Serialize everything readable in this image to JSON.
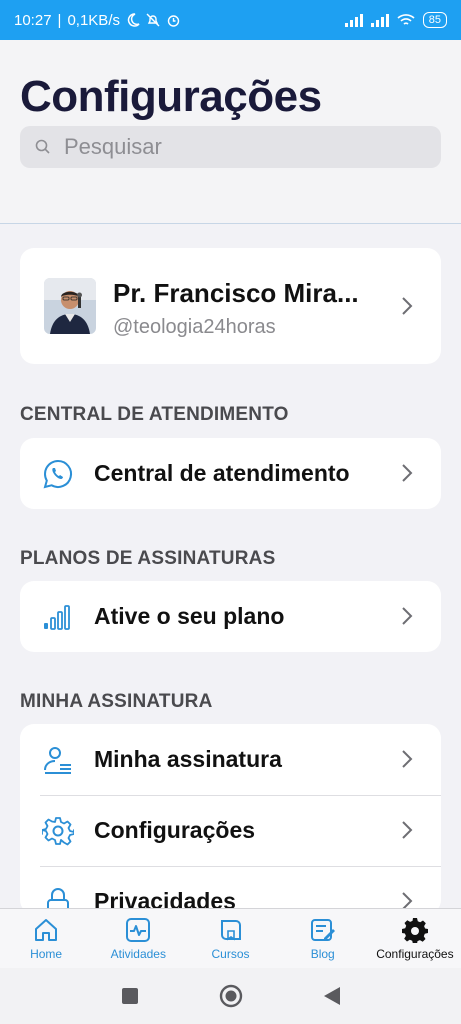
{
  "status": {
    "time": "10:27",
    "speed": "0,1KB/s",
    "battery": "85"
  },
  "header": {
    "title": "Configurações",
    "search_placeholder": "Pesquisar"
  },
  "profile": {
    "name": "Pr. Francisco Mira...",
    "handle": "@teologia24horas"
  },
  "sections": {
    "central": {
      "title": "CENTRAL DE ATENDIMENTO",
      "item": "Central de atendimento",
      "icon": "whatsapp-icon"
    },
    "planos": {
      "title": "PLANOS DE ASSINATURAS",
      "item": "Ative o seu plano",
      "icon": "signal-bars-icon"
    },
    "minha": {
      "title": "MINHA ASSINATURA",
      "items": [
        {
          "label": "Minha assinatura",
          "icon": "user-list-icon"
        },
        {
          "label": "Configurações",
          "icon": "gear-icon"
        },
        {
          "label": "Privacidades",
          "icon": "lock-icon"
        }
      ]
    }
  },
  "tabbar": {
    "tabs": [
      {
        "label": "Home",
        "icon": "home-icon"
      },
      {
        "label": "Atividades",
        "icon": "activity-icon"
      },
      {
        "label": "Cursos",
        "icon": "book-icon"
      },
      {
        "label": "Blog",
        "icon": "blog-icon"
      },
      {
        "label": "Configurações",
        "icon": "gear-icon",
        "active": true
      }
    ]
  },
  "colors": {
    "accent": "#2b8fd6",
    "status_bar": "#1ea0f2",
    "title": "#1a1a3a"
  }
}
